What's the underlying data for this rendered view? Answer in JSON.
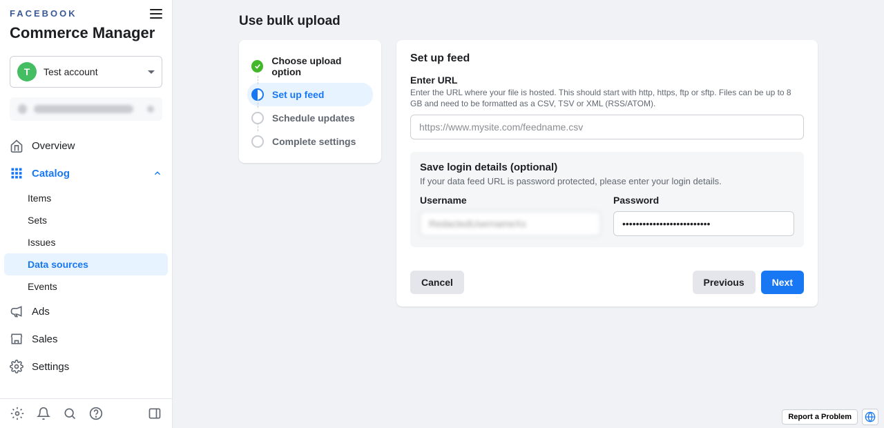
{
  "brand": {
    "wordmark": "FACEBOOK",
    "app_title": "Commerce Manager"
  },
  "account": {
    "initial": "T",
    "name": "Test account"
  },
  "sidebar": {
    "items": [
      {
        "label": "Overview"
      },
      {
        "label": "Catalog"
      },
      {
        "label": "Ads"
      },
      {
        "label": "Sales"
      },
      {
        "label": "Settings"
      }
    ],
    "catalog_sub": [
      {
        "label": "Items"
      },
      {
        "label": "Sets"
      },
      {
        "label": "Issues"
      },
      {
        "label": "Data sources"
      },
      {
        "label": "Events"
      }
    ]
  },
  "page": {
    "title": "Use bulk upload"
  },
  "stepper": {
    "steps": [
      {
        "label": "Choose upload option"
      },
      {
        "label": "Set up feed"
      },
      {
        "label": "Schedule updates"
      },
      {
        "label": "Complete settings"
      }
    ]
  },
  "panel": {
    "title": "Set up feed",
    "url_label": "Enter URL",
    "url_help": "Enter the URL where your file is hosted. This should start with http, https, ftp or sftp. Files can be up to 8 GB and need to be formatted as a CSV, TSV or XML (RSS/ATOM).",
    "url_placeholder": "https://www.mysite.com/feedname.csv",
    "url_value": "",
    "login": {
      "title": "Save login details (optional)",
      "help": "If your data feed URL is password protected, please enter your login details.",
      "username_label": "Username",
      "username_value": "RedactedUsernameXx",
      "password_label": "Password",
      "password_value": "••••••••••••••••••••••••••"
    },
    "buttons": {
      "cancel": "Cancel",
      "previous": "Previous",
      "next": "Next"
    }
  },
  "footer": {
    "report": "Report a Problem"
  }
}
